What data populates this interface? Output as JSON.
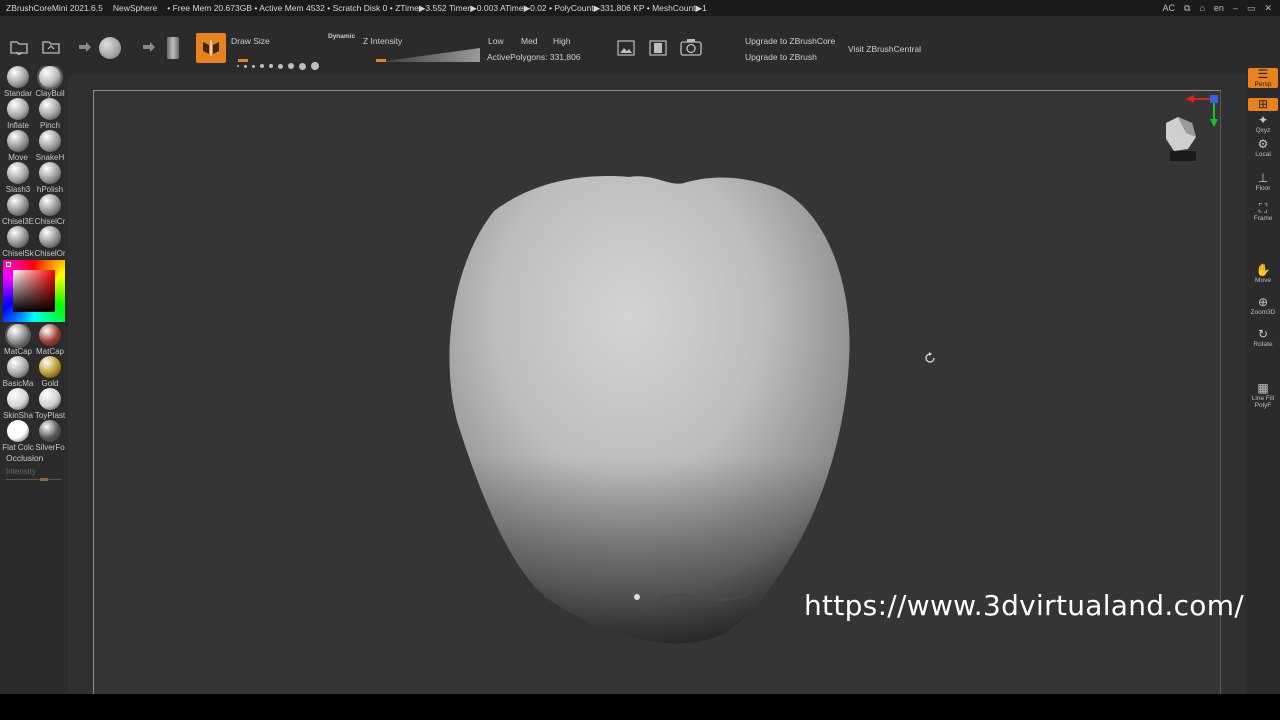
{
  "titlebar": {
    "app": "ZBrushCoreMini 2021.6.5",
    "document": "NewSphere",
    "stats": "• Free Mem 20.673GB • Active Mem 4532 • Scratch Disk 0 • ZTime▶3.552 Timer▶0.003 ATime▶0.02 • PolyCount▶331.806 KP • MeshCount▶1",
    "right_ac": "AC",
    "lang": "en"
  },
  "toolbar": {
    "draw_size_label": "Draw Size",
    "dynamic_label": "Dynamic",
    "z_intensity_label": "Z Intensity",
    "low_label": "Low",
    "med_label": "Med",
    "high_label": "High",
    "active_polygons": "ActivePolygons: 331,806",
    "upgrade_core": "Upgrade to ZBrushCore",
    "upgrade_zbrush": "Upgrade to ZBrush",
    "visit_central": "Visit ZBrushCentral"
  },
  "brushes": [
    {
      "label": "Standar",
      "color": "#9c9c9c"
    },
    {
      "label": "ClayBuil",
      "color": "#b5b5b5",
      "selected": true
    },
    {
      "label": "Inflate",
      "color": "#a8a8a8"
    },
    {
      "label": "Pinch",
      "color": "#a0a0a0"
    },
    {
      "label": "Move",
      "color": "#8f8f8f"
    },
    {
      "label": "SnakeH",
      "color": "#9a9a9a"
    },
    {
      "label": "Slash3",
      "color": "#a3a3a3"
    },
    {
      "label": "hPolish",
      "color": "#979797"
    },
    {
      "label": "Chisel3E",
      "color": "#8a8a8a"
    },
    {
      "label": "ChiselCr",
      "color": "#8e8e8e"
    },
    {
      "label": "ChiselSk",
      "color": "#8a8a8a"
    },
    {
      "label": "ChiselOr",
      "color": "#8c8c8c"
    }
  ],
  "materials": [
    {
      "label": "MatCap",
      "color": "#8c8c8c",
      "selected": true
    },
    {
      "label": "MatCap",
      "color": "#9b3a2a"
    },
    {
      "label": "BasicMa",
      "color": "#a5a5a5"
    },
    {
      "label": "Gold",
      "color": "#b8941f"
    },
    {
      "label": "SkinSha",
      "color": "#d5d5d5"
    },
    {
      "label": "ToyPlast",
      "color": "#cfcfcf"
    },
    {
      "label": "Flat Colc",
      "color": "#ffffff"
    },
    {
      "label": "SilverFo",
      "color": "#555555"
    }
  ],
  "left": {
    "occlusion_label": "Occlusion",
    "intensity_label": "Intensity"
  },
  "right_buttons": [
    {
      "label": "Persp",
      "icon": "persp-icon",
      "orange": true
    },
    {
      "label": "",
      "icon": "floor-grid-icon",
      "orange": true
    },
    {
      "label": "Qxyz",
      "icon": "xyz-icon"
    },
    {
      "label": "Local",
      "icon": "local-icon"
    },
    {
      "label": "Floor",
      "icon": "floor-icon"
    },
    {
      "label": "Frame",
      "icon": "frame-icon"
    },
    {
      "label": "Move",
      "icon": "move-hand-icon"
    },
    {
      "label": "Zoom3D",
      "icon": "zoom-icon"
    },
    {
      "label": "Rotate",
      "icon": "rotate-icon"
    },
    {
      "label": "Line Fill PolyF",
      "icon": "polyframe-icon"
    }
  ],
  "watermark": {
    "url": "https://www.3dvirtualand.com/"
  },
  "colors": {
    "accent": "#e8821e",
    "panel": "#2b2b2b",
    "canvas": "#353535"
  }
}
